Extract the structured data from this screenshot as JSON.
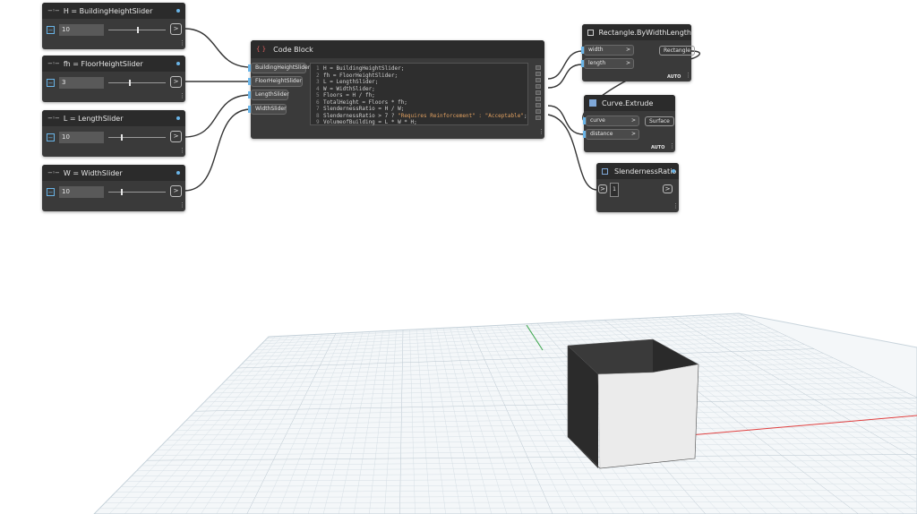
{
  "sliders": [
    {
      "title": "H = BuildingHeightSlider",
      "value": "10",
      "thumb": 0.5
    },
    {
      "title": "fh = FloorHeightSlider",
      "value": "3",
      "thumb": 0.35
    },
    {
      "title": "L = LengthSlider",
      "value": "10",
      "thumb": 0.22
    },
    {
      "title": "W = WidthSlider",
      "value": "10",
      "thumb": 0.22
    }
  ],
  "code_block": {
    "title": "Code Block",
    "inputs": [
      "BuildingHeightSlider",
      "FloorHeightSlider",
      "LengthSlider",
      "WidthSlider"
    ],
    "lines": [
      {
        "n": "1",
        "text": "H = BuildingHeightSlider;"
      },
      {
        "n": "2",
        "text": "fh = FloorHeightSlider;"
      },
      {
        "n": "3",
        "text": "L = LengthSlider;"
      },
      {
        "n": "4",
        "text": "W = WidthSlider;"
      },
      {
        "n": "5",
        "text": "Floors = H / fh;"
      },
      {
        "n": "6",
        "text": "TotalHeight = Floors * fh;"
      },
      {
        "n": "7",
        "text": "SlendernessRatio = H / W;"
      },
      {
        "n": "8",
        "text": "SlendernessRatio > 7 ? ",
        "str": "\"Requires Reinforcement\" : \"Acceptable\"",
        "tail": ";"
      },
      {
        "n": "9",
        "text": "VolumeofBuilding = L * W * H;"
      }
    ]
  },
  "rect_node": {
    "title": "Rectangle.ByWidthLength",
    "inputs": [
      "width",
      "length"
    ],
    "output": "Rectangle",
    "mode": "AUTO"
  },
  "extrude_node": {
    "title": "Curve.Extrude",
    "inputs": [
      "curve",
      "distance"
    ],
    "output": "Surface",
    "mode": "AUTO"
  },
  "watch_node": {
    "title": "SlendernessRatio",
    "value": "1"
  },
  "ui": {
    "expand_glyph": "−",
    "port_glyph": ">",
    "slider_icon": "−◦−",
    "more_glyph": "⋮",
    "code_icon": "{ }"
  }
}
